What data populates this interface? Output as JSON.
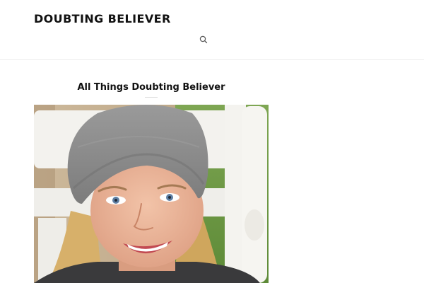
{
  "header": {
    "site_title": "DOUBTING BELIEVER",
    "search_icon": "search-icon"
  },
  "widget": {
    "title": "All Things Doubting Believer"
  },
  "photo": {
    "subject": "selfie-photo",
    "colors": {
      "grass": "#6f9a45",
      "chair": "#f3f2ee",
      "hat": "#8a8a8a",
      "skin": "#e9b69c",
      "hair": "#d7b06a"
    }
  }
}
